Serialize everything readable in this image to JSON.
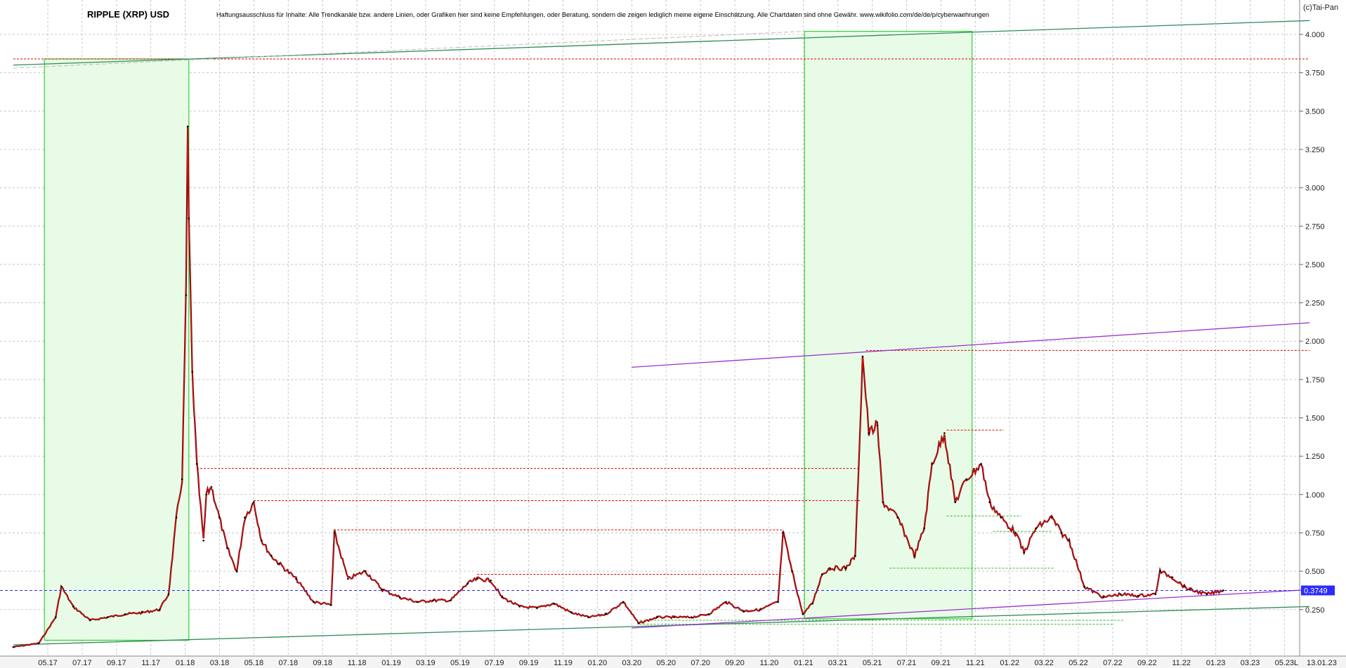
{
  "chart_data": {
    "type": "candlestick-line",
    "title": "RIPPLE (XRP) USD",
    "disclaimer": "Haftungsausschluss für Inhalte: Alle Trendkanäle bzw. andere Linien, oder Grafiken hier sind keine Empfehlungen, oder Beratung, sondern die zeigen lediglich meine eigene Einschätzung. Alle Chartdaten sind ohne Gewähr.  www.wikifolio.com/de/de/p/cyberwaehrungen",
    "copyright": "(c)Tai-Pan",
    "date_label": "13.01.23",
    "axis_corner": "L",
    "current_price": 0.3749,
    "current_price_label": "0.3749",
    "ylim": [
      0.1,
      4.25
    ],
    "grid": true,
    "y_ticks": [
      "4.000",
      "3.750",
      "3.500",
      "3.250",
      "3.000",
      "2.750",
      "2.500",
      "2.250",
      "2.000",
      "1.750",
      "1.500",
      "1.250",
      "1.000",
      "0.750",
      "0.500",
      "0.250"
    ],
    "x_ticks": [
      "05.17",
      "07.17",
      "09.17",
      "11.17",
      "01.18",
      "03.18",
      "05.18",
      "07.18",
      "09.18",
      "11.18",
      "01.19",
      "03.19",
      "05.19",
      "07.19",
      "09.19",
      "11.19",
      "01.20",
      "03.20",
      "05.20",
      "07.20",
      "09.20",
      "11.20",
      "01.21",
      "03.21",
      "05.21",
      "07.21",
      "09.21",
      "11.21",
      "01.22",
      "03.22",
      "05.22",
      "07.22",
      "09.22",
      "11.22",
      "01.23",
      "03.23",
      "05.23"
    ],
    "price_series": {
      "x": [
        "2017-03-01",
        "2017-04-15",
        "2017-05-15",
        "2017-05-25",
        "2017-06-15",
        "2017-07-15",
        "2017-08-15",
        "2017-09-15",
        "2017-10-15",
        "2017-11-15",
        "2017-12-01",
        "2017-12-15",
        "2017-12-25",
        "2018-01-01",
        "2018-01-04",
        "2018-01-06",
        "2018-01-12",
        "2018-01-20",
        "2018-02-01",
        "2018-02-06",
        "2018-02-15",
        "2018-03-01",
        "2018-03-15",
        "2018-04-01",
        "2018-04-15",
        "2018-05-01",
        "2018-05-15",
        "2018-06-01",
        "2018-06-15",
        "2018-07-15",
        "2018-08-15",
        "2018-09-15",
        "2018-09-21",
        "2018-10-15",
        "2018-11-15",
        "2018-12-15",
        "2019-01-15",
        "2019-02-15",
        "2019-03-15",
        "2019-04-15",
        "2019-05-15",
        "2019-06-01",
        "2019-06-25",
        "2019-07-15",
        "2019-08-15",
        "2019-09-15",
        "2019-10-15",
        "2019-11-15",
        "2019-12-15",
        "2020-01-15",
        "2020-02-15",
        "2020-03-13",
        "2020-04-15",
        "2020-05-15",
        "2020-06-15",
        "2020-07-15",
        "2020-08-15",
        "2020-09-15",
        "2020-10-15",
        "2020-11-15",
        "2020-11-24",
        "2020-12-10",
        "2020-12-29",
        "2021-01-15",
        "2021-02-01",
        "2021-02-15",
        "2021-03-15",
        "2021-04-01",
        "2021-04-14",
        "2021-04-25",
        "2021-05-10",
        "2021-05-20",
        "2021-06-15",
        "2021-07-15",
        "2021-08-01",
        "2021-08-15",
        "2021-09-06",
        "2021-09-25",
        "2021-10-15",
        "2021-11-10",
        "2021-11-25",
        "2021-12-15",
        "2022-01-10",
        "2022-01-25",
        "2022-02-15",
        "2022-03-15",
        "2022-04-01",
        "2022-04-15",
        "2022-05-12",
        "2022-06-15",
        "2022-07-15",
        "2022-08-15",
        "2022-09-15",
        "2022-09-23",
        "2022-10-15",
        "2022-11-05",
        "2022-11-15",
        "2022-12-15",
        "2023-01-13"
      ],
      "y": [
        0.006,
        0.03,
        0.2,
        0.4,
        0.27,
        0.18,
        0.2,
        0.22,
        0.23,
        0.25,
        0.35,
        0.85,
        1.1,
        2.3,
        3.4,
        2.8,
        1.8,
        1.2,
        0.7,
        1.0,
        1.05,
        0.85,
        0.65,
        0.5,
        0.85,
        0.95,
        0.7,
        0.6,
        0.55,
        0.45,
        0.3,
        0.28,
        0.75,
        0.45,
        0.5,
        0.38,
        0.33,
        0.3,
        0.31,
        0.31,
        0.42,
        0.45,
        0.44,
        0.33,
        0.27,
        0.26,
        0.29,
        0.23,
        0.2,
        0.22,
        0.3,
        0.16,
        0.2,
        0.2,
        0.2,
        0.22,
        0.3,
        0.24,
        0.25,
        0.3,
        0.75,
        0.5,
        0.22,
        0.29,
        0.48,
        0.52,
        0.52,
        0.6,
        1.9,
        1.4,
        1.45,
        0.95,
        0.85,
        0.6,
        0.78,
        1.2,
        1.4,
        0.95,
        1.1,
        1.2,
        0.95,
        0.85,
        0.75,
        0.62,
        0.78,
        0.85,
        0.75,
        0.7,
        0.4,
        0.33,
        0.35,
        0.34,
        0.35,
        0.5,
        0.46,
        0.4,
        0.38,
        0.35,
        0.3749
      ]
    },
    "horizontal_levels_red": [
      3.84,
      1.94,
      1.42,
      1.17,
      0.96,
      0.77,
      0.48
    ],
    "horizontal_levels_green": [
      0.86,
      0.76,
      0.52,
      0.18,
      0.155
    ],
    "trend_lines": [
      {
        "color": "green",
        "from": [
          "2017-03-01",
          3.8
        ],
        "to": [
          "2023-06-15",
          4.09
        ]
      },
      {
        "color": "green",
        "from": [
          "2017-03-01",
          0.02
        ],
        "to": [
          "2023-06-15",
          0.27
        ]
      },
      {
        "color": "purple",
        "from": [
          "2020-03-01",
          1.83
        ],
        "to": [
          "2023-06-15",
          2.12
        ]
      },
      {
        "color": "purple",
        "from": [
          "2020-03-01",
          0.13
        ],
        "to": [
          "2023-06-15",
          0.38
        ]
      }
    ],
    "highlight_zones": [
      {
        "start": "2017-04-25",
        "end": "2018-01-06",
        "low": 0.05,
        "high": 3.84
      },
      {
        "start": "2021-01-01",
        "end": "2021-10-25",
        "low": 0.19,
        "high": 4.02
      }
    ],
    "colors": {
      "line": "#ee0000",
      "zone_fill": "#e8fbe6",
      "zone_border": "#32cd32",
      "trend_green": "#2e8b57",
      "trend_purple": "#9932cc",
      "level_red": "#e00000",
      "level_green": "#33bb33",
      "price_line": "#2b2bff",
      "grid": "#c8c8c8"
    }
  }
}
